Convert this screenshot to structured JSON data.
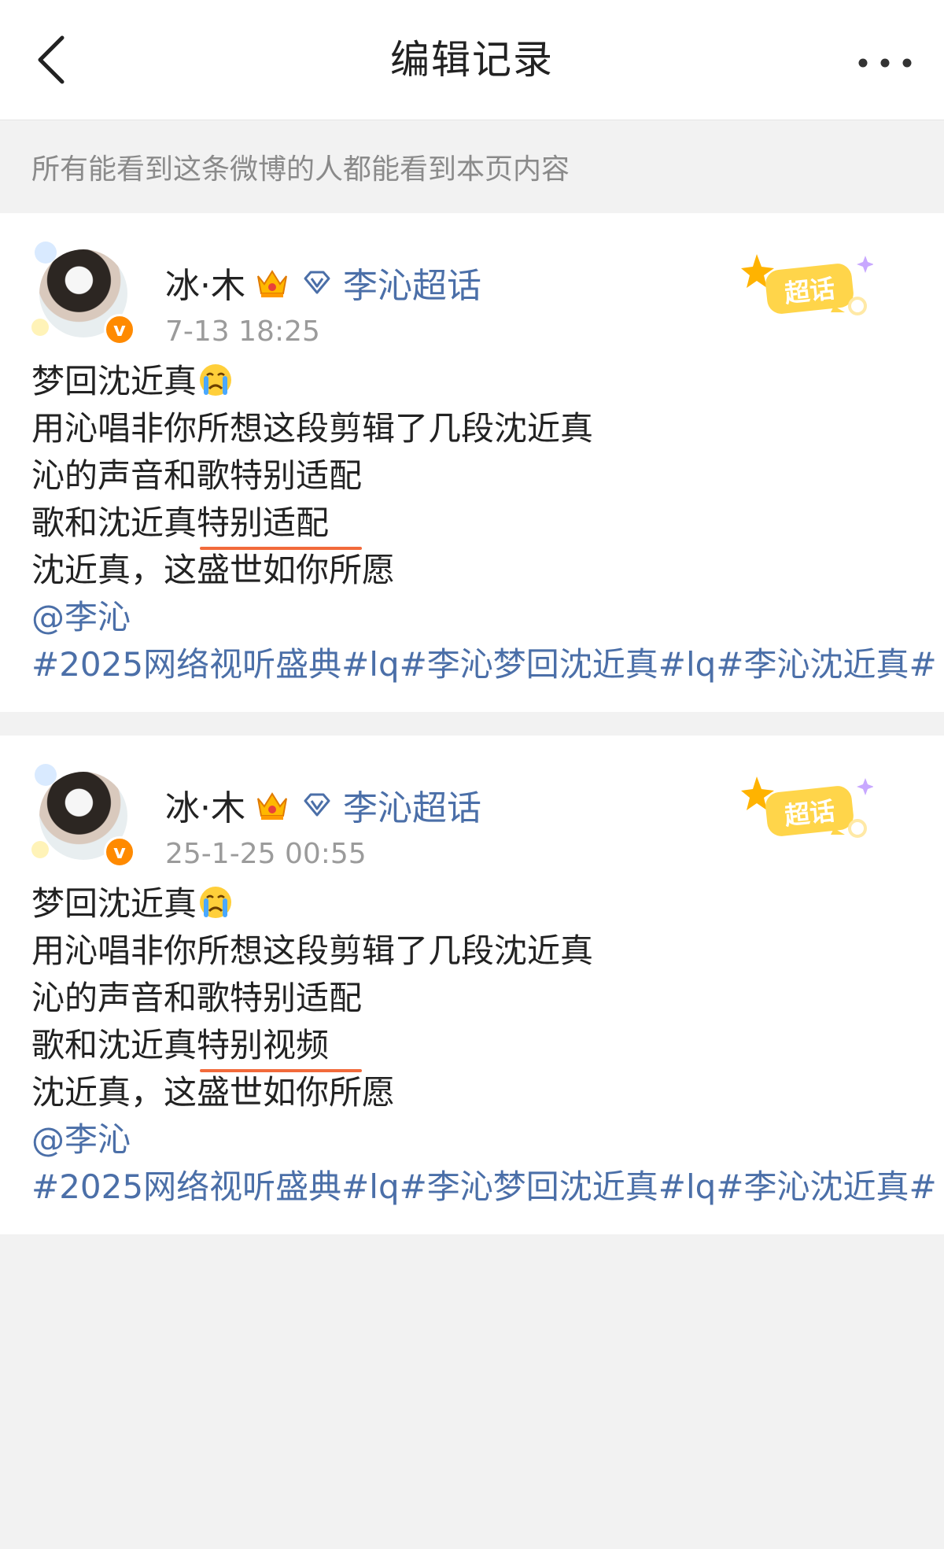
{
  "header": {
    "title": "编辑记录"
  },
  "notice": "所有能看到这条微博的人都能看到本页内容",
  "badge_label": "超话",
  "posts": [
    {
      "author": "冰·木",
      "topic": "李沁超话",
      "time": "7-13 18:25",
      "verified_mark": "v",
      "lines": {
        "l1": "梦回沈近真",
        "l2": "用沁唱非你所想这段剪辑了几段沈近真",
        "l3": "沁的声音和歌特别适配",
        "l4a": "歌和沈近真",
        "l4b": "特别适配",
        "l5": "沈近真，这盛世如你所愿",
        "mention": "@李沁",
        "tags": "#2025网络视听盛典#lq#李沁梦回沈近真#lq#李沁沈近真#"
      }
    },
    {
      "author": "冰·木",
      "topic": "李沁超话",
      "time": "25-1-25 00:55",
      "verified_mark": "v",
      "lines": {
        "l1": "梦回沈近真",
        "l2": "用沁唱非你所想这段剪辑了几段沈近真",
        "l3": "沁的声音和歌特别适配",
        "l4a": "歌和沈近真",
        "l4b": "特别视频",
        "l5": "沈近真，这盛世如你所愿",
        "mention": "@李沁",
        "tags": "#2025网络视听盛典#lq#李沁梦回沈近真#lq#李沁沈近真#"
      }
    }
  ],
  "colors": {
    "link": "#4b6fa8",
    "highlight_underline": "#f26a3b",
    "verified": "#ff8a00"
  }
}
